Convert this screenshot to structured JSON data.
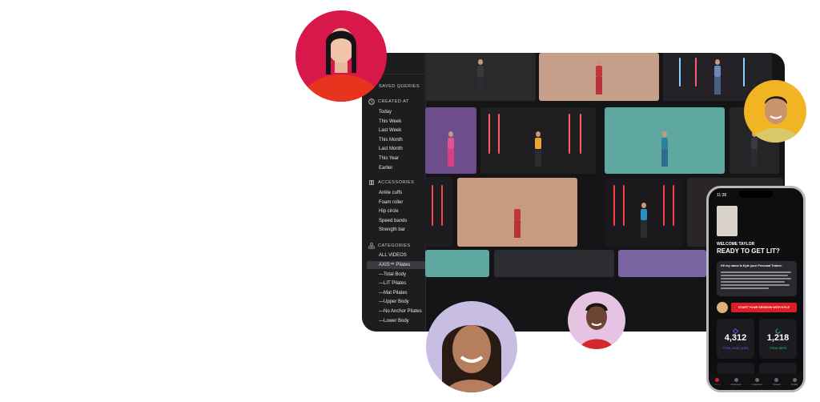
{
  "sidebar": {
    "saved_queries": "SAVED QUERIES",
    "created_at": {
      "heading": "CREATED AT",
      "icon": "clock-icon",
      "items": [
        "Today",
        "This Week",
        "Last Week",
        "This Month",
        "Last Month",
        "This Year",
        "Earlier"
      ]
    },
    "accessories": {
      "heading": "ACCESSORIES",
      "icon": "accessories-icon",
      "items": [
        "Ankle cuffs",
        "Foam roller",
        "Hip circle",
        "Speed bands",
        "Strength bar"
      ]
    },
    "categories": {
      "heading": "CATEGORIES",
      "icon": "categories-icon",
      "items": [
        "ALL VIDEOS",
        "AXIS™ Pilates",
        "—Total Body",
        "—LIT Pilates",
        "—Mat Pilates",
        "—Upper Body",
        "—No Anchor Pilates",
        "—Lower Body"
      ],
      "selected": "AXIS™ Pilates"
    }
  },
  "phone": {
    "time": "11:38",
    "welcome": "WELCOME TAYLOR",
    "ready": "READY TO GET LIT?",
    "bubble_title": "Hi! my name is Kyle your Personal Trainer.",
    "cta": "START YOUR SESSION WITH KYLE",
    "stats": [
      {
        "value": "4,312",
        "label": "TOTAL VIDEO (LBS)",
        "color": "#7b5cff"
      },
      {
        "value": "1,218",
        "label": "TOTAL REPS",
        "color": "#2fd37a"
      }
    ],
    "tabs": [
      "Home",
      "Workouts",
      "Collection",
      "Stream",
      "Profile"
    ],
    "accent": "#e01d25"
  }
}
